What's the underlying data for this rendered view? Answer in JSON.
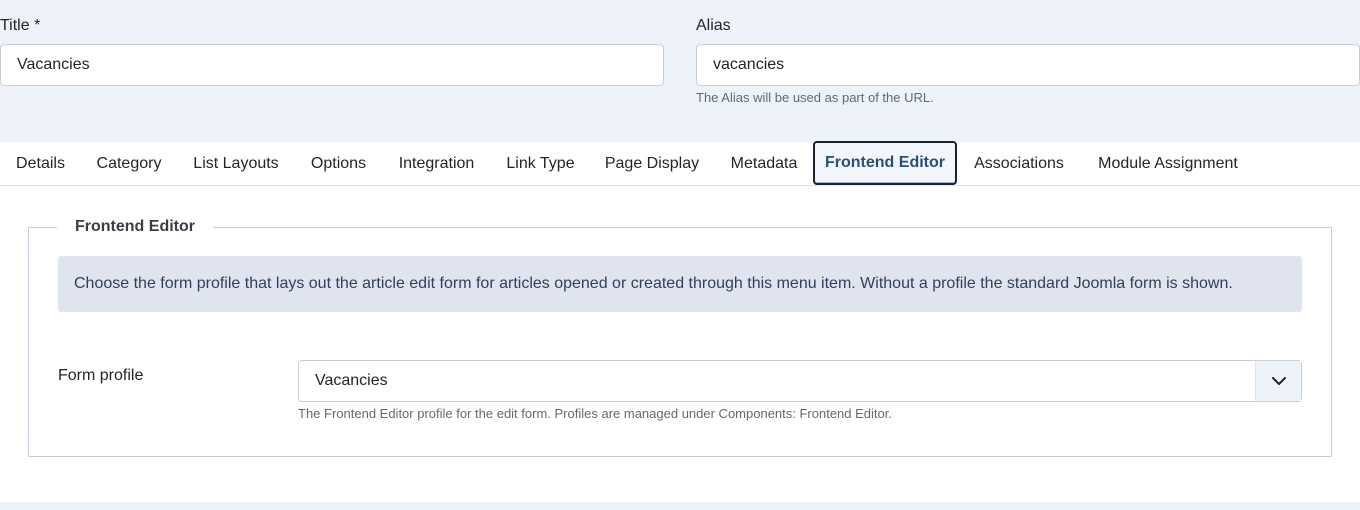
{
  "title_field": {
    "label": "Title *",
    "value": "Vacancies"
  },
  "alias_field": {
    "label": "Alias",
    "value": "vacancies",
    "hint": "The Alias will be used as part of the URL."
  },
  "tabs": [
    {
      "label": "Details"
    },
    {
      "label": "Category"
    },
    {
      "label": "List Layouts"
    },
    {
      "label": "Options"
    },
    {
      "label": "Integration"
    },
    {
      "label": "Link Type"
    },
    {
      "label": "Page Display"
    },
    {
      "label": "Metadata"
    },
    {
      "label": "Frontend Editor",
      "active": true
    },
    {
      "label": "Associations"
    },
    {
      "label": "Module Assignment"
    }
  ],
  "fieldset": {
    "legend": "Frontend Editor",
    "info": "Choose the form profile that lays out the article edit form for articles opened or created through this menu item. Without a profile the standard Joomla form is shown.",
    "form_profile": {
      "label": "Form profile",
      "selected": "Vacancies",
      "hint": "The Frontend Editor profile for the edit form. Profiles are managed under Components: Frontend Editor.",
      "icon": "chevron-down-icon"
    }
  },
  "colors": {
    "page_background": "#eef3fa",
    "active_tab_text": "#2d4e78",
    "info_background": "#dfe4ef"
  }
}
